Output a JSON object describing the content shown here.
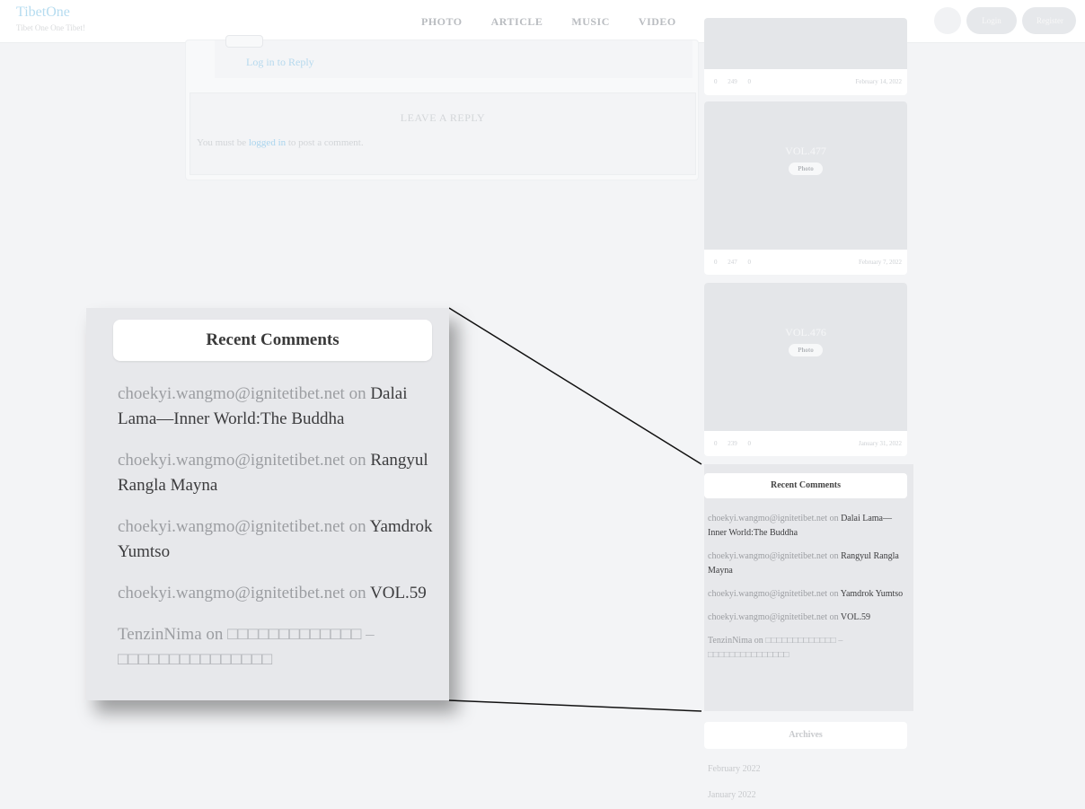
{
  "header": {
    "brand_name": "TibetOne",
    "brand_tagline": "Tibet One One Tibet!",
    "nav": [
      "PHOTO",
      "ARTICLE",
      "MUSIC",
      "VIDEO"
    ],
    "login_label": "Login",
    "register_label": "Register"
  },
  "comments_area": {
    "log_in_to_reply": "Log in to Reply",
    "leave_reply_title": "LEAVE A REPLY",
    "must_be_prefix": "You must be ",
    "logged_in_link": "logged in",
    "must_be_suffix": " to post a comment."
  },
  "sidebar_posts": [
    {
      "title": "",
      "tag": "",
      "views": "249",
      "comments": "0",
      "likes": "0",
      "date": "February 14, 2022"
    },
    {
      "title": "VOL.477",
      "tag": "Photo",
      "views": "247",
      "comments": "0",
      "likes": "0",
      "date": "February 7, 2022"
    },
    {
      "title": "VOL.476",
      "tag": "Photo",
      "views": "239",
      "comments": "0",
      "likes": "0",
      "date": "January 31, 2022"
    }
  ],
  "recent_comments": {
    "heading": "Recent Comments",
    "items": [
      {
        "author": "choekyi.wangmo@ignitetibet.net",
        "on": "on",
        "post": "Dalai Lama—Inner World:The Buddha"
      },
      {
        "author": "choekyi.wangmo@ignitetibet.net",
        "on": "on",
        "post": "Rangyul Rangla Mayna"
      },
      {
        "author": "choekyi.wangmo@ignitetibet.net",
        "on": "on",
        "post": "Yamdrok Yumtso"
      },
      {
        "author": "choekyi.wangmo@ignitetibet.net",
        "on": "on",
        "post": "VOL.59"
      },
      {
        "author": "TenzinNima",
        "on": "on",
        "post": "□□□□□□□□□□□□□ – □□□□□□□□□□□□□□□"
      }
    ]
  },
  "archives": {
    "heading": "Archives",
    "items": [
      "February 2022",
      "January 2022"
    ]
  },
  "colors": {
    "brand": "#b6dcf0",
    "link": "#a9d4ee",
    "panel_bg": "#e7e8eb",
    "page_bg": "#f3f4f6"
  }
}
